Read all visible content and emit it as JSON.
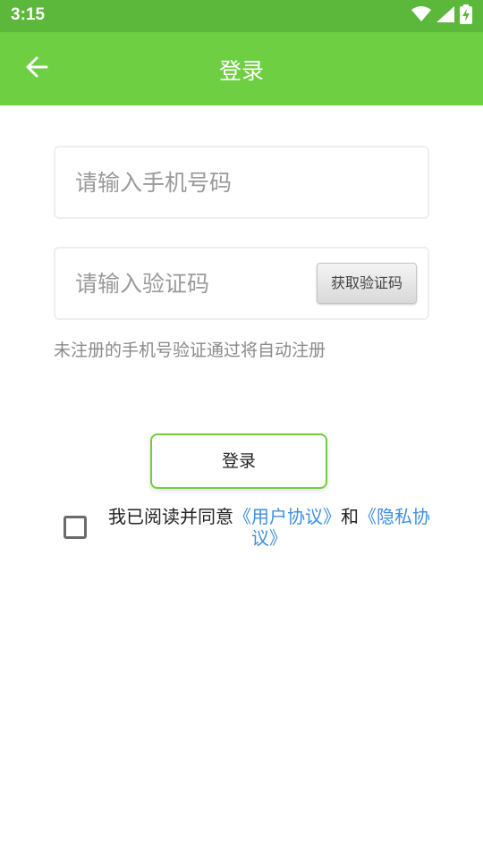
{
  "status_bar": {
    "time": "3:15",
    "icons": [
      "wifi-icon",
      "signal-icon",
      "battery-charging-icon"
    ]
  },
  "toolbar": {
    "back_icon": "arrow-left-icon",
    "title": "登录"
  },
  "form": {
    "phone_placeholder": "请输入手机号码",
    "phone_value": "",
    "code_placeholder": "请输入验证码",
    "code_value": "",
    "get_code_label": "获取验证码",
    "hint": "未注册的手机号验证通过将自动注册"
  },
  "login_button": "登录",
  "agreement": {
    "checked": false,
    "prefix": "我已阅读并同意",
    "user_agreement": "《用户协议》",
    "and": "和",
    "privacy_policy": "《隐私协议》"
  },
  "colors": {
    "status_bar": "#5bb83a",
    "toolbar": "#6dcf41",
    "link": "#3d8fe0"
  }
}
